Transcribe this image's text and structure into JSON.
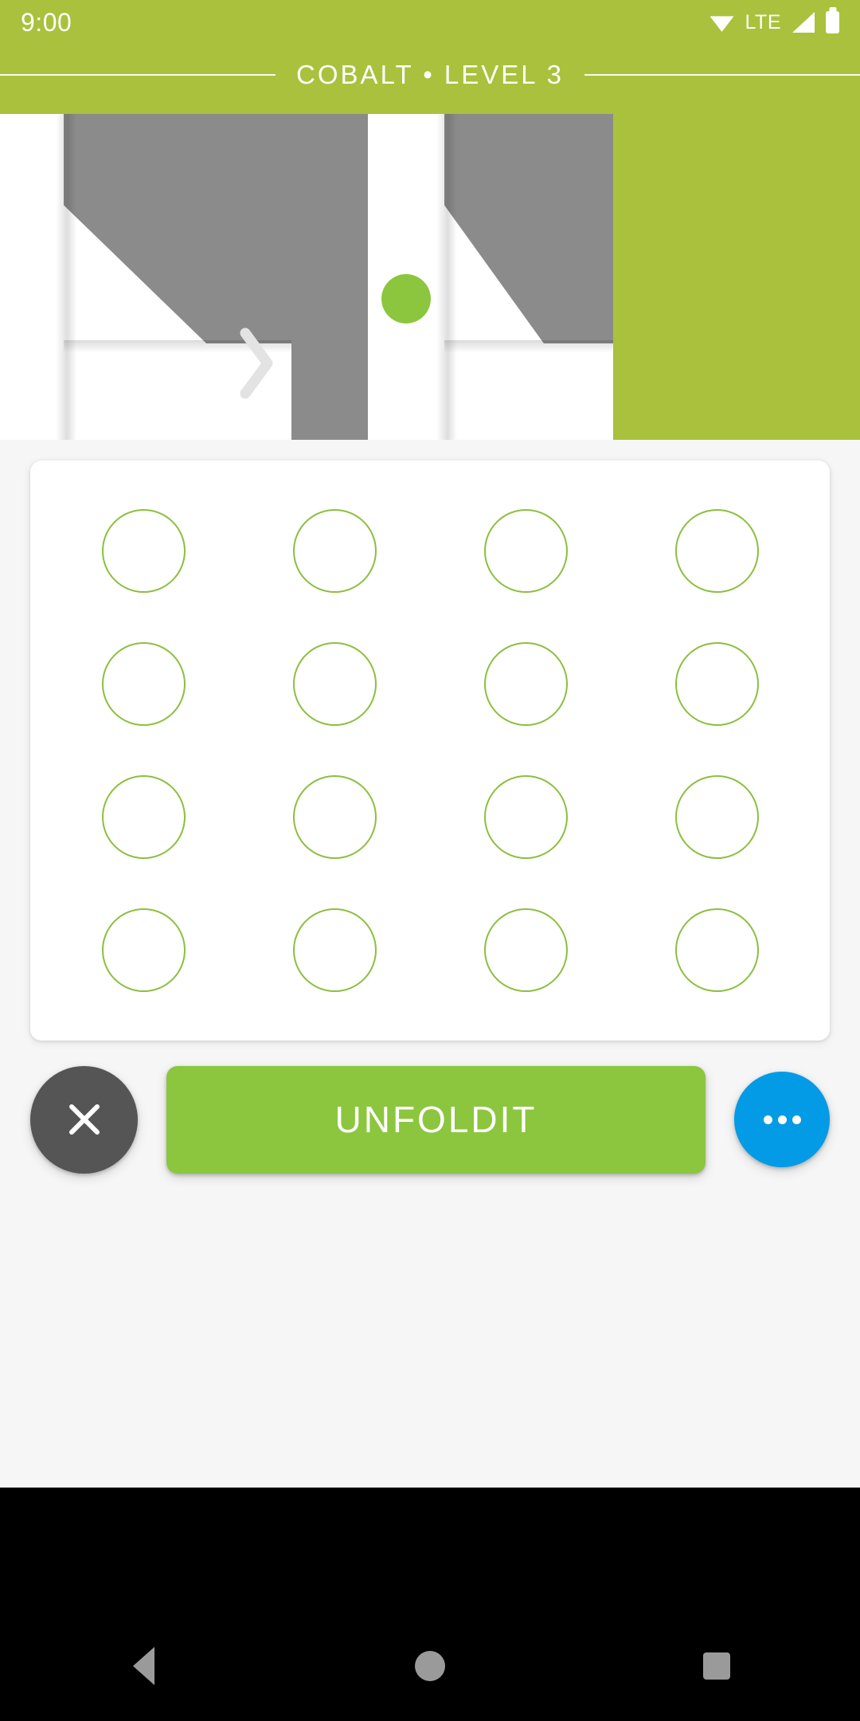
{
  "status_bar": {
    "clock": "9:00",
    "network_label": "LTE",
    "icons": [
      "wifi-icon",
      "signal-icon",
      "battery-icon"
    ]
  },
  "header": {
    "title": "COBALT  •  LEVEL 3",
    "level_name": "COBALT",
    "level_number": "LEVEL 3",
    "background_color": "#A9C13C"
  },
  "puzzle": {
    "separator_icon": "chevron-right-icon",
    "before_shape": {
      "paper_color": "#FFFFFF",
      "fold_color": "#8B8B8B"
    },
    "after_shape": {
      "paper_color": "#FFFFFF",
      "fold_color": "#8B8B8B",
      "target_dot_color": "#8CC63E"
    }
  },
  "answer_grid": {
    "rows": 4,
    "columns": 4,
    "circle_color": "#8CBF3F",
    "cells": [
      {
        "id": "slot-1",
        "state": "empty"
      },
      {
        "id": "slot-2",
        "state": "empty"
      },
      {
        "id": "slot-3",
        "state": "empty"
      },
      {
        "id": "slot-4",
        "state": "empty"
      },
      {
        "id": "slot-5",
        "state": "empty"
      },
      {
        "id": "slot-6",
        "state": "empty"
      },
      {
        "id": "slot-7",
        "state": "empty"
      },
      {
        "id": "slot-8",
        "state": "empty"
      },
      {
        "id": "slot-9",
        "state": "empty"
      },
      {
        "id": "slot-10",
        "state": "empty"
      },
      {
        "id": "slot-11",
        "state": "empty"
      },
      {
        "id": "slot-12",
        "state": "empty"
      },
      {
        "id": "slot-13",
        "state": "empty"
      },
      {
        "id": "slot-14",
        "state": "empty"
      },
      {
        "id": "slot-15",
        "state": "empty"
      },
      {
        "id": "slot-16",
        "state": "empty"
      }
    ]
  },
  "actions": {
    "close_icon": "close-icon",
    "close_color": "#555555",
    "primary_label": "UNFOLDIT",
    "primary_color": "#8CC63E",
    "more_icon": "more-horizontal-icon",
    "more_color": "#039BE5"
  },
  "nav_bar": {
    "back_icon": "back-triangle-icon",
    "home_icon": "home-circle-icon",
    "recents_icon": "recents-square-icon"
  }
}
